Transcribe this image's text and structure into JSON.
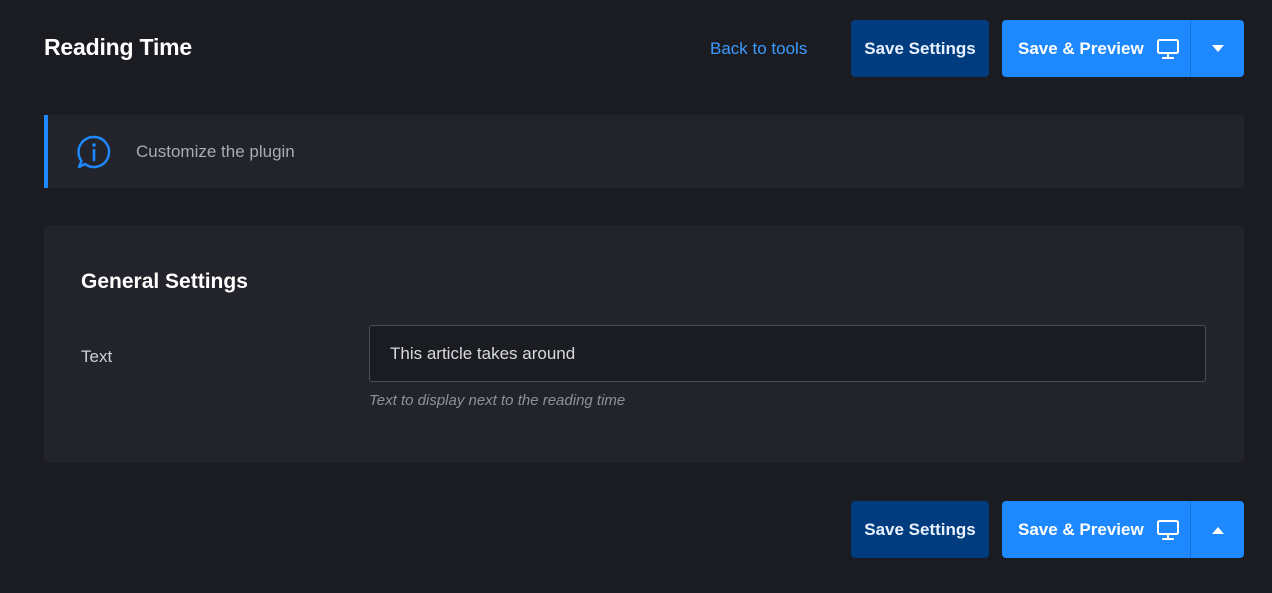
{
  "header": {
    "title": "Reading Time",
    "back_link": "Back to tools",
    "save_settings": "Save Settings",
    "save_preview": "Save & Preview"
  },
  "info": {
    "message": "Customize the plugin",
    "icon": "info-icon"
  },
  "general": {
    "title": "General Settings",
    "fields": [
      {
        "label": "Text",
        "value": "This article takes around",
        "help": "Text to display next to the reading time"
      }
    ]
  },
  "footer": {
    "save_settings": "Save Settings",
    "save_preview": "Save & Preview"
  },
  "colors": {
    "background": "#1b1c21",
    "panel": "#23242b",
    "accent": "#1e88ff",
    "save_button": "#003c7e",
    "link": "#3d9bff"
  }
}
